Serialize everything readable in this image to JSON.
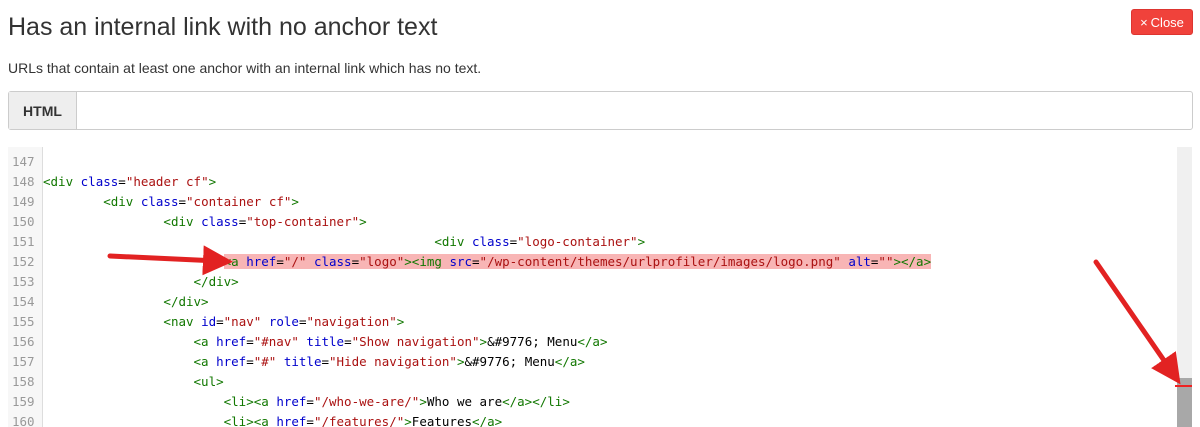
{
  "header": {
    "title": "Has an internal link with no anchor text",
    "close_label": "Close",
    "close_icon": "×"
  },
  "subtitle": "URLs that contain at least one anchor with an internal link which has no text.",
  "tabs": [
    {
      "label": "HTML"
    }
  ],
  "editor": {
    "highlighted_line": 152,
    "lines": [
      {
        "n": "147",
        "c": []
      },
      {
        "n": "148",
        "c": [
          [
            "t",
            "<div "
          ],
          [
            "a",
            "class"
          ],
          [
            "p",
            "="
          ],
          [
            "s",
            "\"header cf\""
          ],
          [
            "t",
            ">"
          ]
        ]
      },
      {
        "n": "149",
        "c": [
          [
            "p",
            "        "
          ],
          [
            "t",
            "<div "
          ],
          [
            "a",
            "class"
          ],
          [
            "p",
            "="
          ],
          [
            "s",
            "\"container cf\""
          ],
          [
            "t",
            ">"
          ]
        ]
      },
      {
        "n": "150",
        "c": [
          [
            "p",
            "                "
          ],
          [
            "t",
            "<div "
          ],
          [
            "a",
            "class"
          ],
          [
            "p",
            "="
          ],
          [
            "s",
            "\"top-container\""
          ],
          [
            "t",
            ">"
          ]
        ]
      },
      {
        "n": "151",
        "c": [
          [
            "p",
            "                                                    "
          ],
          [
            "t",
            "<div "
          ],
          [
            "a",
            "class"
          ],
          [
            "p",
            "="
          ],
          [
            "s",
            "\"logo-container\""
          ],
          [
            "t",
            ">"
          ]
        ]
      },
      {
        "n": "152",
        "c": [
          [
            "p",
            "                        "
          ],
          [
            "t",
            "<a "
          ],
          [
            "a",
            "href"
          ],
          [
            "p",
            "="
          ],
          [
            "s",
            "\"/\""
          ],
          [
            "p",
            " "
          ],
          [
            "a",
            "class"
          ],
          [
            "p",
            "="
          ],
          [
            "s",
            "\"logo\""
          ],
          [
            "t",
            "><img "
          ],
          [
            "a",
            "src"
          ],
          [
            "p",
            "="
          ],
          [
            "s",
            "\"/wp-content/themes/urlprofiler/images/logo.png\""
          ],
          [
            "p",
            " "
          ],
          [
            "a",
            "alt"
          ],
          [
            "p",
            "="
          ],
          [
            "s",
            "\"\""
          ],
          [
            "t",
            "></a>"
          ]
        ]
      },
      {
        "n": "153",
        "c": [
          [
            "p",
            "                    "
          ],
          [
            "t",
            "</div>"
          ]
        ]
      },
      {
        "n": "154",
        "c": [
          [
            "p",
            "                "
          ],
          [
            "t",
            "</div>"
          ]
        ]
      },
      {
        "n": "155",
        "c": [
          [
            "p",
            "                "
          ],
          [
            "t",
            "<nav "
          ],
          [
            "a",
            "id"
          ],
          [
            "p",
            "="
          ],
          [
            "s",
            "\"nav\""
          ],
          [
            "p",
            " "
          ],
          [
            "a",
            "role"
          ],
          [
            "p",
            "="
          ],
          [
            "s",
            "\"navigation\""
          ],
          [
            "t",
            ">"
          ]
        ]
      },
      {
        "n": "156",
        "c": [
          [
            "p",
            "                    "
          ],
          [
            "t",
            "<a "
          ],
          [
            "a",
            "href"
          ],
          [
            "p",
            "="
          ],
          [
            "s",
            "\"#nav\""
          ],
          [
            "p",
            " "
          ],
          [
            "a",
            "title"
          ],
          [
            "p",
            "="
          ],
          [
            "s",
            "\"Show navigation\""
          ],
          [
            "t",
            ">"
          ],
          [
            "p",
            "&#9776; Menu"
          ],
          [
            "t",
            "</a>"
          ]
        ]
      },
      {
        "n": "157",
        "c": [
          [
            "p",
            "                    "
          ],
          [
            "t",
            "<a "
          ],
          [
            "a",
            "href"
          ],
          [
            "p",
            "="
          ],
          [
            "s",
            "\"#\""
          ],
          [
            "p",
            " "
          ],
          [
            "a",
            "title"
          ],
          [
            "p",
            "="
          ],
          [
            "s",
            "\"Hide navigation\""
          ],
          [
            "t",
            ">"
          ],
          [
            "p",
            "&#9776; Menu"
          ],
          [
            "t",
            "</a>"
          ]
        ]
      },
      {
        "n": "158",
        "c": [
          [
            "p",
            "                    "
          ],
          [
            "t",
            "<ul>"
          ]
        ]
      },
      {
        "n": "159",
        "c": [
          [
            "p",
            "                        "
          ],
          [
            "t",
            "<li><a "
          ],
          [
            "a",
            "href"
          ],
          [
            "p",
            "="
          ],
          [
            "s",
            "\"/who-we-are/\""
          ],
          [
            "t",
            ">"
          ],
          [
            "p",
            "Who we are"
          ],
          [
            "t",
            "</a></li>"
          ]
        ]
      },
      {
        "n": "160",
        "c": [
          [
            "p",
            "                        "
          ],
          [
            "t",
            "<li><a "
          ],
          [
            "a",
            "href"
          ],
          [
            "p",
            "="
          ],
          [
            "s",
            "\"/features/\""
          ],
          [
            "t",
            ">"
          ],
          [
            "p",
            "Features"
          ],
          [
            "t",
            "</a>"
          ]
        ]
      }
    ]
  },
  "colors": {
    "close_bg": "#f0423b",
    "highlight": "#f8b5b5",
    "arrow": "#e22222"
  }
}
